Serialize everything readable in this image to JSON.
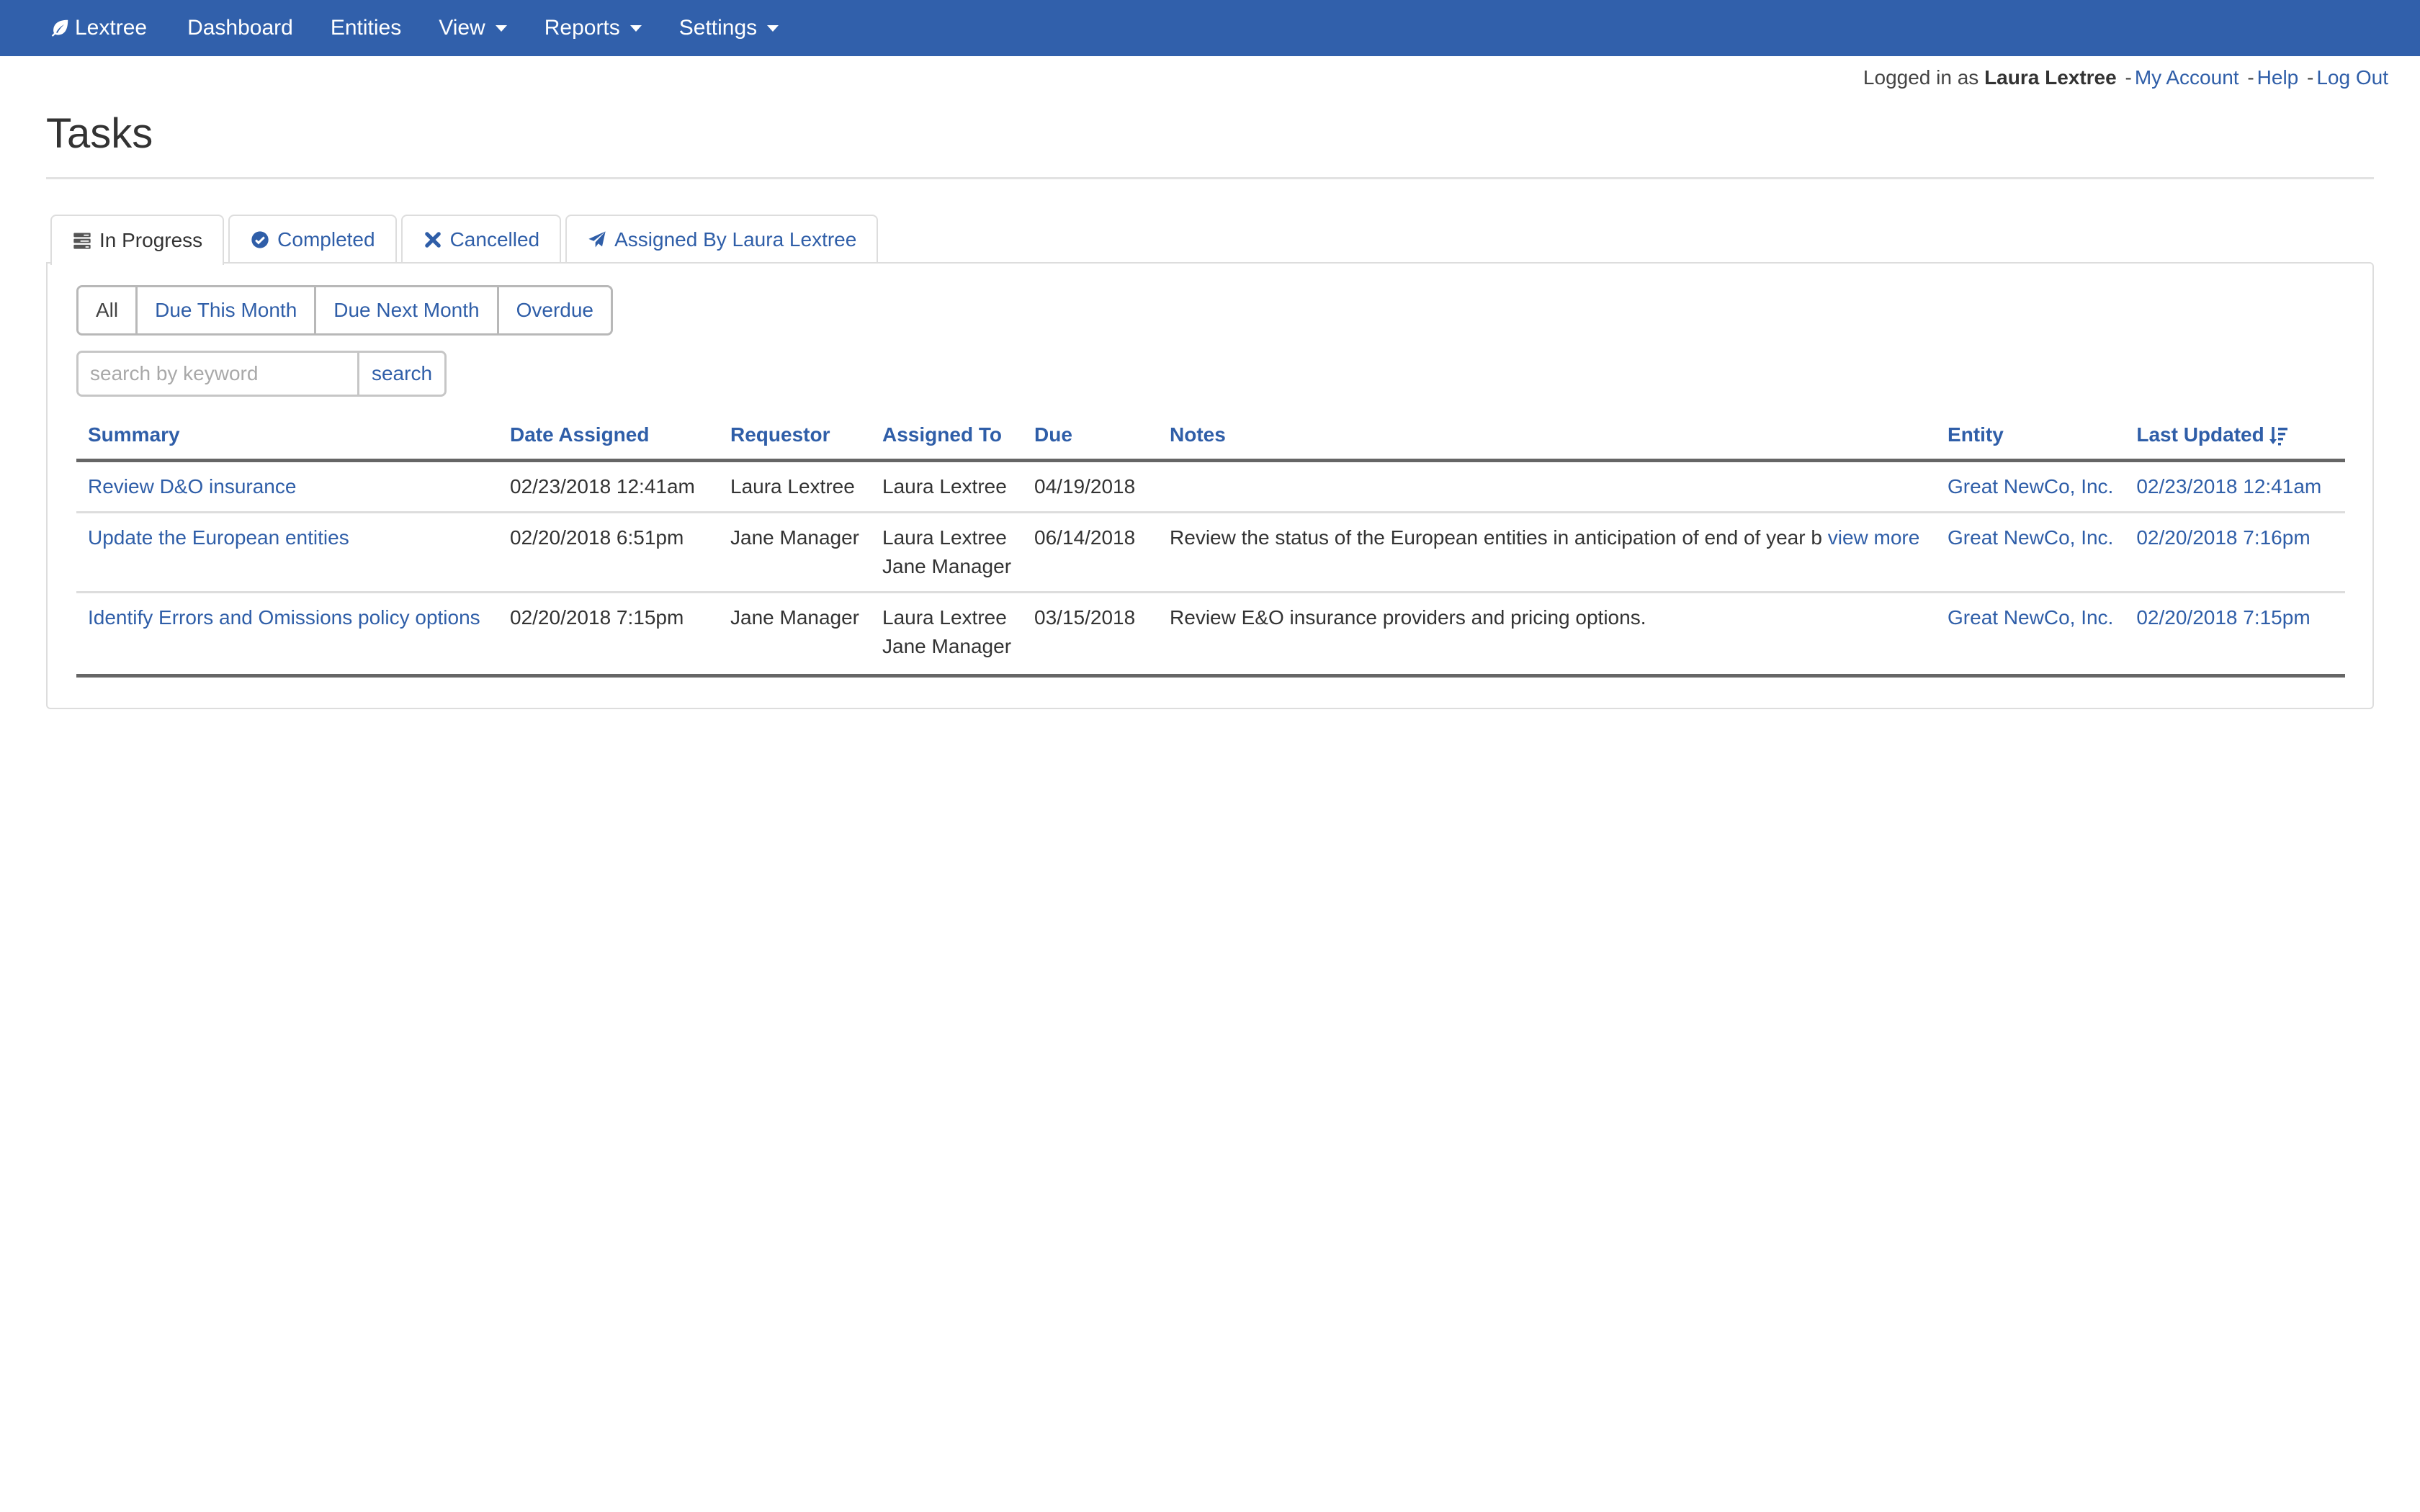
{
  "navbar": {
    "brand": "Lextree",
    "items": [
      {
        "label": "Dashboard",
        "dropdown": false
      },
      {
        "label": "Entities",
        "dropdown": false
      },
      {
        "label": "View",
        "dropdown": true
      },
      {
        "label": "Reports",
        "dropdown": true
      },
      {
        "label": "Settings",
        "dropdown": true
      }
    ],
    "color": "#3160ab"
  },
  "userbar": {
    "prefix": "Logged in as",
    "user": "Laura Lextree",
    "links": [
      "My Account",
      "Help",
      "Log Out"
    ],
    "separator": "-"
  },
  "page": {
    "title": "Tasks"
  },
  "tabs": [
    {
      "label": "In Progress",
      "icon": "tasks-icon",
      "active": true
    },
    {
      "label": "Completed",
      "icon": "check-circle-icon",
      "active": false
    },
    {
      "label": "Cancelled",
      "icon": "times-icon",
      "active": false
    },
    {
      "label": "Assigned By Laura Lextree",
      "icon": "paper-plane-icon",
      "active": false
    }
  ],
  "filters": [
    {
      "label": "All",
      "active": true
    },
    {
      "label": "Due This Month",
      "active": false
    },
    {
      "label": "Due Next Month",
      "active": false
    },
    {
      "label": "Overdue",
      "active": false
    }
  ],
  "search": {
    "placeholder": "search by keyword",
    "value": "",
    "button_label": "search"
  },
  "table": {
    "columns": [
      "Summary",
      "Date Assigned",
      "Requestor",
      "Assigned To",
      "Due",
      "Notes",
      "Entity",
      "Last Updated"
    ],
    "sort_column": "Last Updated",
    "sort_direction": "descending",
    "rows": [
      {
        "summary": "Review D&O insurance",
        "date_assigned": "02/23/2018 12:41am",
        "requestor": "Laura Lextree",
        "assigned_to": [
          "Laura Lextree"
        ],
        "due": "04/19/2018",
        "notes": "",
        "notes_more": "",
        "entity": "Great NewCo, Inc.",
        "last_updated": "02/23/2018 12:41am"
      },
      {
        "summary": "Update the European entities",
        "date_assigned": "02/20/2018 6:51pm",
        "requestor": "Jane Manager",
        "assigned_to": [
          "Laura Lextree",
          "Jane Manager"
        ],
        "due": "06/14/2018",
        "notes": "Review the status of the European entities in anticipation of end of year b",
        "notes_more": "view more",
        "entity": "Great NewCo, Inc.",
        "last_updated": "02/20/2018 7:16pm"
      },
      {
        "summary": "Identify Errors and Omissions policy options",
        "date_assigned": "02/20/2018 7:15pm",
        "requestor": "Jane Manager",
        "assigned_to": [
          "Laura Lextree",
          "Jane Manager"
        ],
        "due": "03/15/2018",
        "notes": "Review E&O insurance providers and pricing options.",
        "notes_more": "",
        "entity": "Great NewCo, Inc.",
        "last_updated": "02/20/2018 7:15pm"
      }
    ]
  }
}
